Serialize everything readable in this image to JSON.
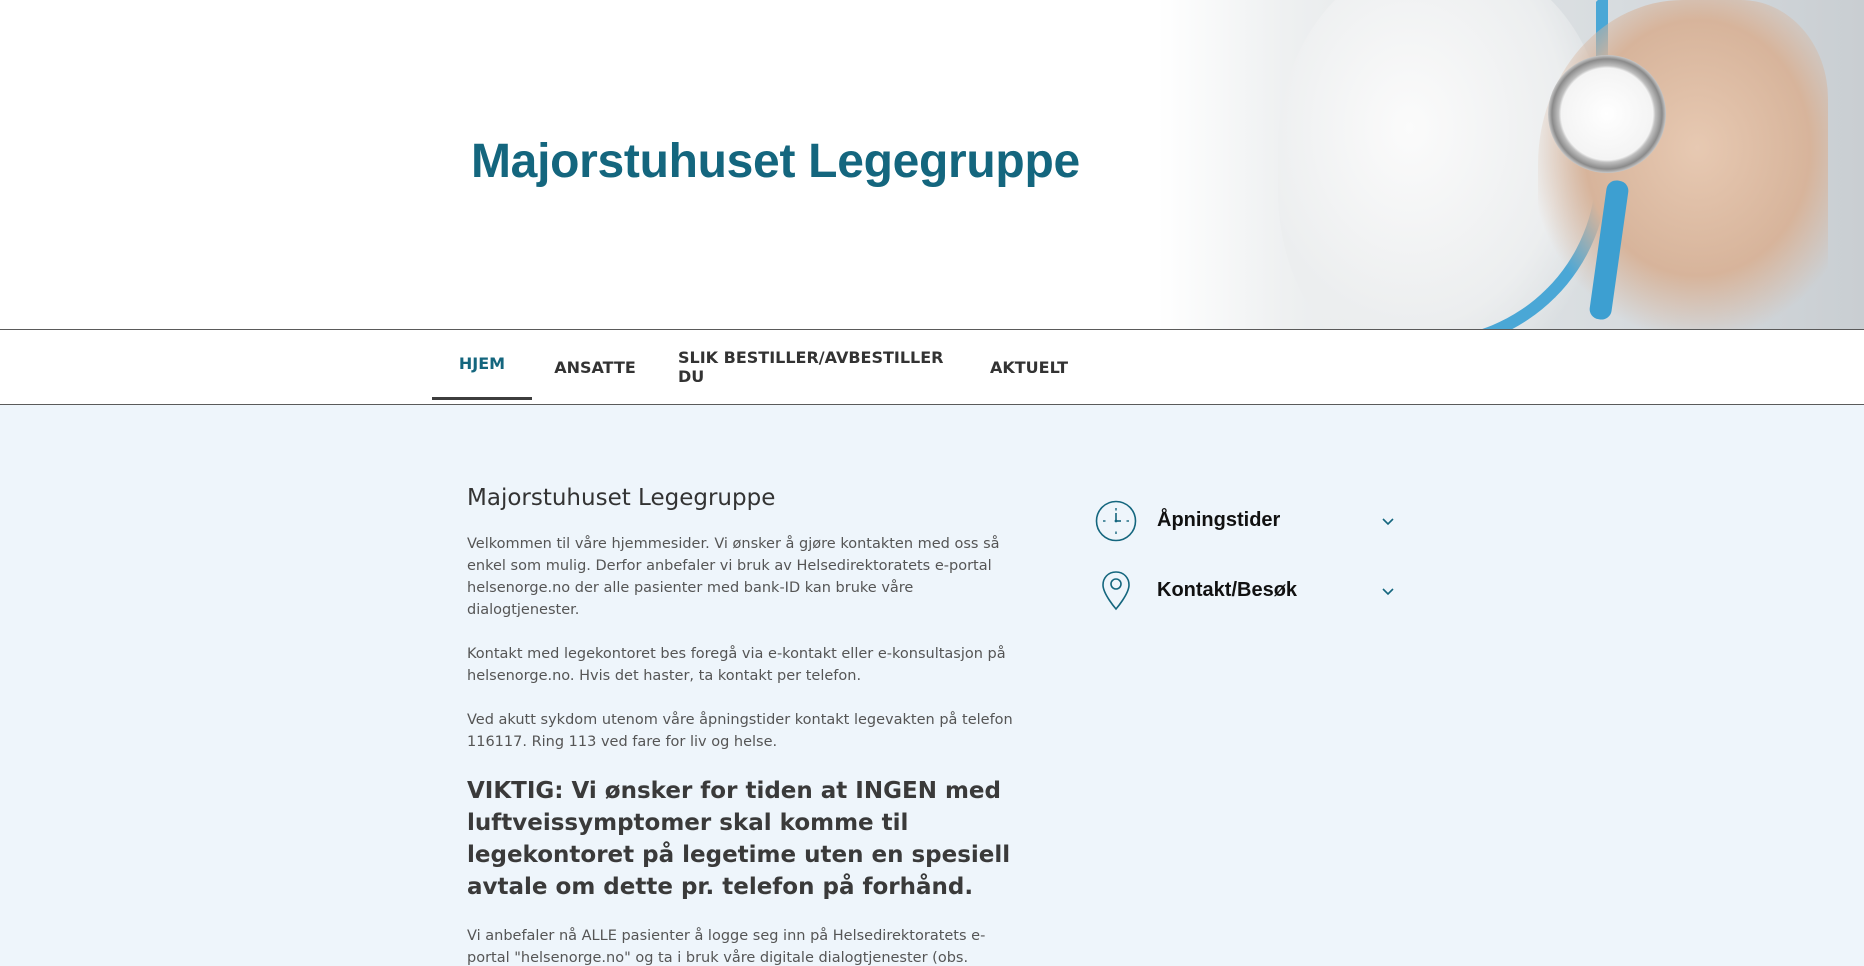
{
  "site": {
    "title": "Majorstuhuset Legegruppe",
    "brand_color": "#14667e"
  },
  "nav": {
    "items": [
      {
        "label": "HJEM",
        "active": true
      },
      {
        "label": "ANSATTE",
        "active": false
      },
      {
        "label": "SLIK BESTILLER/AVBESTILLER DU",
        "active": false
      },
      {
        "label": "AKTUELT",
        "active": false
      }
    ]
  },
  "main": {
    "heading": "Majorstuhuset Legegruppe",
    "paragraphs": [
      "Velkommen til våre hjemmesider. Vi ønsker å gjøre kontakten med oss så enkel som mulig. Derfor anbefaler vi bruk av Helsedirektoratets e-portal helsenorge.no der alle pasienter med bank-ID kan bruke våre dialogtjenester.",
      "Kontakt med legekontoret bes foregå via e-kontakt eller e-konsultasjon på helsenorge.no. Hvis det haster, ta kontakt per telefon.",
      "Ved akutt sykdom utenom våre åpningstider kontakt legevakten på telefon 116117. Ring 113 ved fare for liv og helse."
    ],
    "important": "VIKTIG: Vi ønsker for tiden at INGEN med luftveissymptomer skal komme til legekontoret på legetime uten en spesiell avtale om dette pr. telefon på forhånd.",
    "recommendation": "Vi anbefaler nå ALLE pasienter å logge seg inn på Helsedirektoratets e-portal \"helsenorge.no\" og ta i bruk våre digitale dialogtjenester (obs. begrenset tilgjengelighet under ferieperioder). Du vil bare i unntaksvis måtte gi fullt"
  },
  "sidebar": {
    "opening_hours": {
      "label": "Åpningstider",
      "icon": "clock-icon"
    },
    "contact": {
      "label": "Kontakt/Besøk",
      "icon": "map-pin-icon"
    }
  }
}
